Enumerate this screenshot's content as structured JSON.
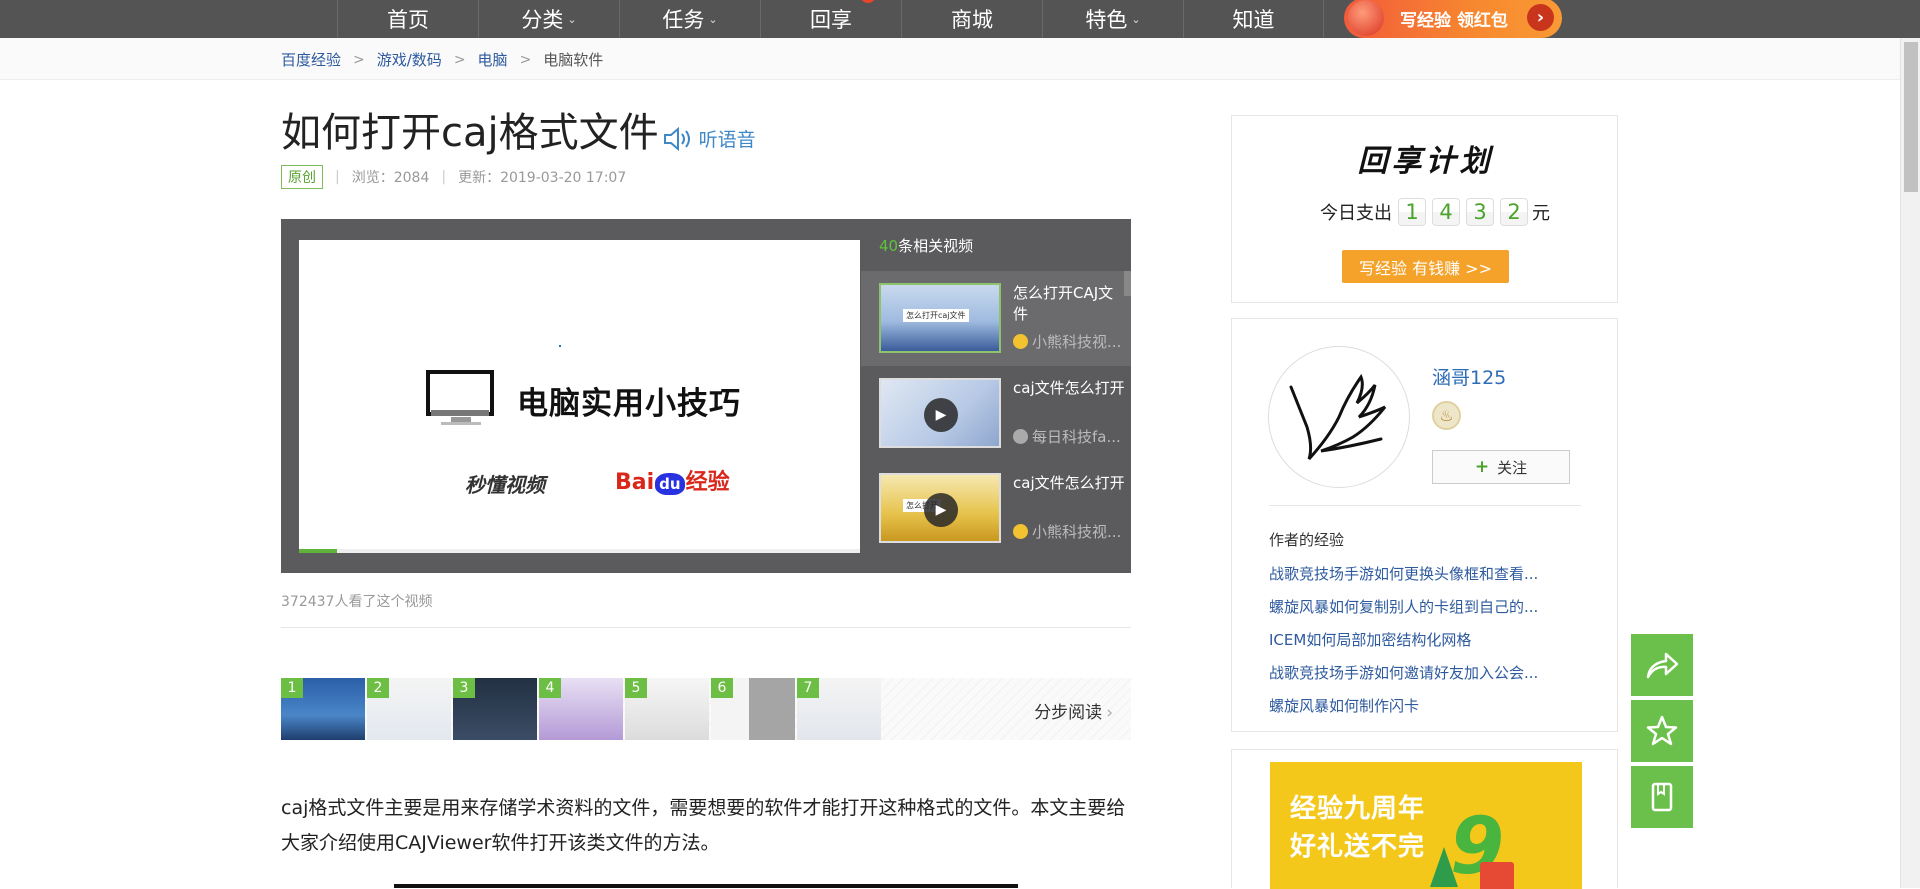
{
  "nav": {
    "items": [
      {
        "label": "首页",
        "caret": false
      },
      {
        "label": "分类",
        "caret": true
      },
      {
        "label": "任务",
        "caret": true
      },
      {
        "label": "回享",
        "caret": false
      },
      {
        "label": "商城",
        "caret": false
      },
      {
        "label": "特色",
        "caret": true
      },
      {
        "label": "知道",
        "caret": false
      }
    ],
    "promo_label": "写经验 领红包",
    "promo_arrow": "›"
  },
  "breadcrumb": [
    "百度经验",
    "游戏/数码",
    "电脑",
    "电脑软件"
  ],
  "article": {
    "title": "如何打开caj格式文件",
    "listen_label": "听语音",
    "original_tag": "原创",
    "views": "浏览：2084",
    "updated": "更新：2019-03-20 17:07",
    "intro": "caj格式文件主要是用来存储学术资料的文件，需要想要的软件才能打开这种格式的文件。本文主要给大家介绍使用CAJViewer软件打开该类文件的方法。"
  },
  "video": {
    "screen_title": "电脑实用小技巧",
    "logo_left": "秒懂视频",
    "logo_baidu_a": "Bai",
    "logo_baidu_paw": "du",
    "logo_baidu_b": "经验",
    "progress": 0.068,
    "related_count": "40",
    "related_suffix": "条相关视频",
    "related": [
      {
        "title": "怎么打开CAJ文件",
        "author": "小熊科技视...",
        "active": true,
        "play": false,
        "thumb_text": "怎么打开caj文件"
      },
      {
        "title": "caj文件怎么打开",
        "author": "每日科技fa...",
        "active": false,
        "play": true,
        "thumb_text": ""
      },
      {
        "title": "caj文件怎么打开",
        "author": "小熊科技视...",
        "active": false,
        "play": true,
        "thumb_text": "怎么打开"
      }
    ],
    "view_count": "372437人看了这个视频"
  },
  "steps": {
    "numbers": [
      "1",
      "2",
      "3",
      "4",
      "5",
      "6",
      "7"
    ],
    "read_label": "分步阅读",
    "read_chevron": "›"
  },
  "plan_card": {
    "title": "回享计划",
    "spend_label": "今日支出",
    "digits": [
      "1",
      "4",
      "3",
      "2"
    ],
    "unit": "元",
    "button": "写经验 有钱赚 >>"
  },
  "author": {
    "name": "涵哥125",
    "badge": "♨",
    "follow_plus": "+",
    "follow_label": "关注",
    "experience_heading": "作者的经验",
    "experiences": [
      "战歌竞技场手游如何更换头像框和查看...",
      "螺旋风暴如何复制别人的卡组到自己的...",
      "ICEM如何局部加密结构化网格",
      "战歌竞技场手游如何邀请好友加入公会...",
      "螺旋风暴如何制作闪卡"
    ]
  },
  "ad": {
    "line1": "经验九周年",
    "line2": "好礼送不完",
    "badge": "9"
  },
  "colors": {
    "nav_bg": "#545454",
    "accent_green": "#6ac04a",
    "link_blue": "#2e5a9e",
    "promo_orange": "#f7882f",
    "earn_orange": "#f4a22a"
  },
  "icons": [
    "caret-down-icon",
    "speaker-icon",
    "play-icon",
    "share-icon",
    "star-icon",
    "bookmark-icon",
    "chevron-right-icon"
  ]
}
